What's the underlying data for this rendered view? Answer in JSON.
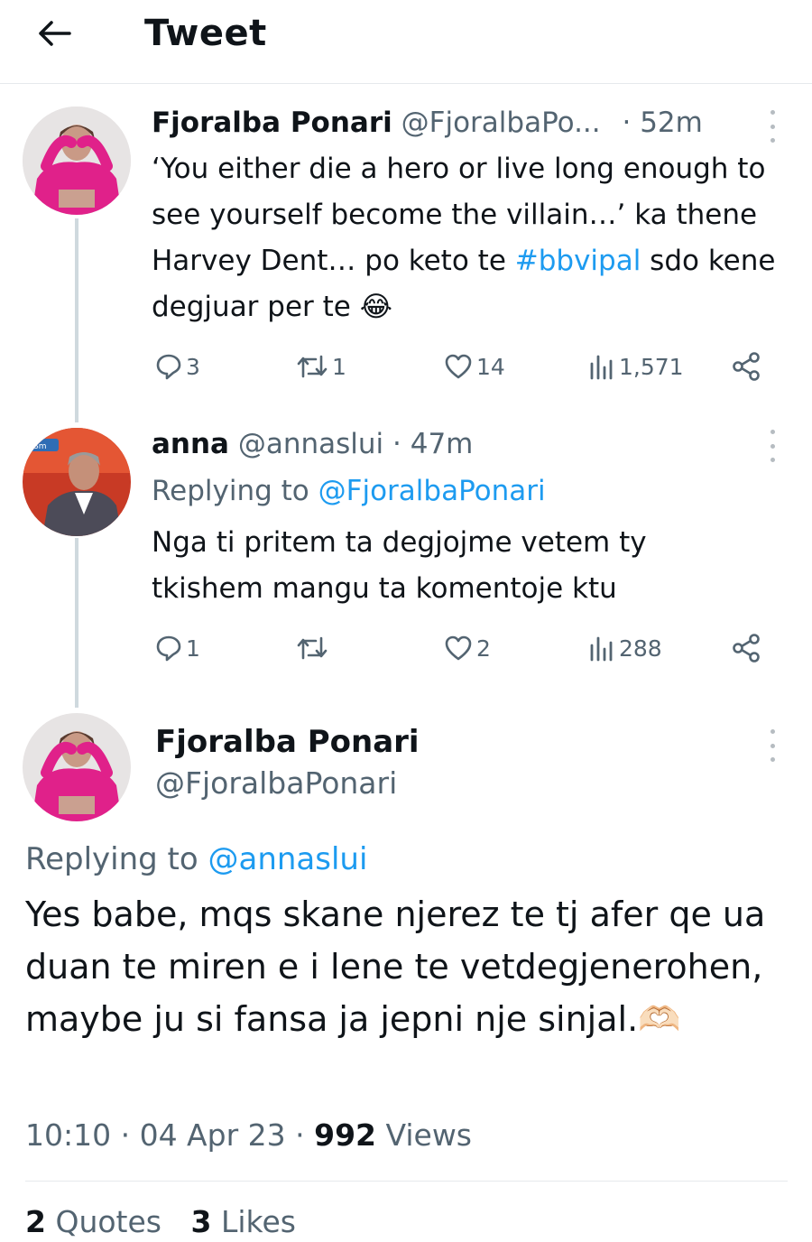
{
  "header": {
    "title": "Tweet"
  },
  "tweets": [
    {
      "name": "Fjoralba Ponari",
      "handle": "@FjoralbaPo...",
      "time": "· 52m",
      "text_before": "‘You either die a hero or live long enough to see yourself become the villain…’ ka thene Harvey Dent… po keto te ",
      "hashtag": "#bbvipal",
      "text_after": " sdo kene degjuar per te 😂",
      "replies": "3",
      "retweets": "1",
      "likes": "14",
      "views": "1,571"
    },
    {
      "name": "anna",
      "handle": "@annaslui",
      "time": "· 47m",
      "replying_prefix": "Replying to",
      "replying_mention": "@FjoralbaPonari",
      "text": "Nga ti pritem ta degjojme vetem ty tkishem mangu ta komentoje ktu",
      "replies": "1",
      "retweets": "",
      "likes": "2",
      "views": "288"
    }
  ],
  "main_tweet": {
    "name": "Fjoralba Ponari",
    "handle": "@FjoralbaPonari",
    "replying_prefix": "Replying to",
    "replying_mention": "@annaslui",
    "text": "Yes babe, mqs skane njerez te tj afer qe ua duan te miren e i lene te vetdegjenerohen, maybe ju si fansa ja jepni nje sinjal.🫶🏻",
    "time": "10:10 · 04 Apr 23 ·",
    "views_count": "992",
    "views_label": "Views",
    "quotes_count": "2",
    "quotes_label": "Quotes",
    "likes_count": "3",
    "likes_label": "Likes"
  },
  "colors": {
    "accent": "#1d9bf0",
    "muted": "#536471",
    "text": "#0f1419",
    "avatar_pink": "#e0218a"
  },
  "icons": [
    "back-arrow-icon",
    "more-icon",
    "reply-icon",
    "retweet-icon",
    "like-icon",
    "views-icon",
    "share-icon"
  ]
}
